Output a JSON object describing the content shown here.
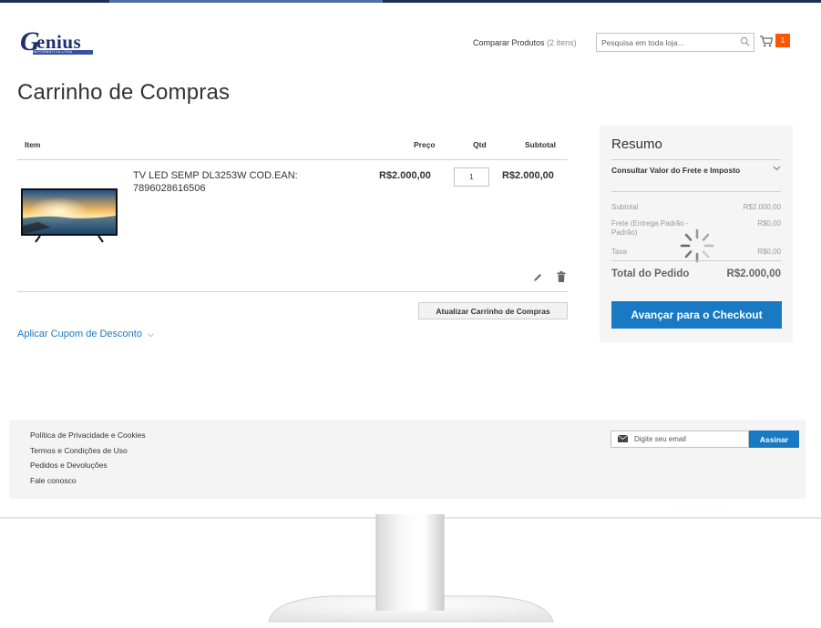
{
  "brand": {
    "logo_initial": "G",
    "logo_name": "enius",
    "logo_tagline": "INFORMÁTICA LTDA"
  },
  "header": {
    "compare_label": "Comparar Produtos",
    "compare_count": "(2 itens)",
    "search_placeholder": "Pesquisa em toda loja...",
    "cart_count": "1",
    "icons": [
      "search-icon",
      "cart-icon"
    ]
  },
  "page_title": "Carrinho de Compras",
  "cart": {
    "columns": {
      "item": "Item",
      "price": "Preço",
      "qty": "Qtd",
      "subtotal": "Subtotal"
    },
    "items": [
      {
        "name": "TV LED SEMP DL3253W COD.EAN: 7896028616506",
        "price": "R$2.000,00",
        "qty": "1",
        "subtotal": "R$2.000,00"
      }
    ],
    "update_button": "Atualizar Carrinho de Compras",
    "coupon_label": "Aplicar Cupom de Desconto"
  },
  "summary": {
    "title": "Resumo",
    "shipping_toggle": "Consultar Valor do Frete e Imposto",
    "rows": [
      {
        "label": "Subtotal",
        "value": "R$2.000,00"
      },
      {
        "label": "Frete (Entrega Padrão - Padrão)",
        "value": "R$0,00"
      },
      {
        "label": "Taxa",
        "value": "R$0,00"
      }
    ],
    "total_label": "Total do Pedido",
    "total_value": "R$2.000,00",
    "checkout_button": "Avançar para o Checkout"
  },
  "footer": {
    "links": [
      "Política de Privacidade e Cookies",
      "Termos e Condições de Uso",
      "Pedidos e Devoluções",
      "Fale conosco"
    ],
    "newsletter_placeholder": "Digite seu email",
    "subscribe_button": "Assinar"
  },
  "colors": {
    "primary_blue": "#1979c3",
    "badge_orange": "#ff5501",
    "logo_navy": "#1d2f6d",
    "summary_bg": "#f5f5f5"
  }
}
